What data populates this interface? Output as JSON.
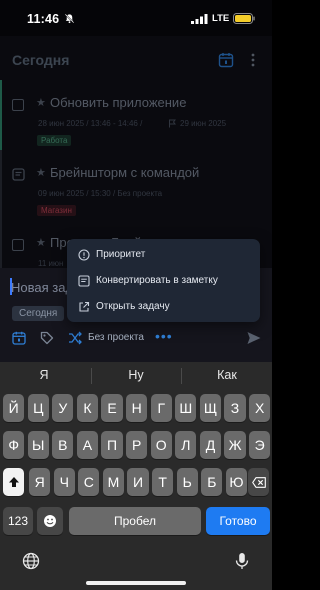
{
  "status_bar": {
    "time": "11:46",
    "network": "LTE"
  },
  "header": {
    "title": "Сегодня"
  },
  "tasks": [
    {
      "title": "Обновить приложение",
      "meta": "28 июн 2025 / 13:46 - 14:46 /",
      "due": "29 июн 2025",
      "tag": "Работа",
      "accent": "#2e8b6f",
      "tag_bg": "#1c3a30",
      "tag_fg": "#52a383"
    },
    {
      "title": "Брейншторм с командой",
      "meta": "09 июн 2025 / 15:30 / Без проекта",
      "tag": "Магазин",
      "accent": "#3a3f4d",
      "tag_bg": "#3a1a22",
      "tag_fg": "#c04558"
    },
    {
      "title": "Провести Брейншторм",
      "meta": "11 июн",
      "accent": "#3a3f4d"
    }
  ],
  "composer": {
    "placeholder": "Новая зада",
    "date_chip": "Сегодня",
    "project": "Без проекта"
  },
  "context_menu": {
    "items": [
      {
        "label": "Приоритет",
        "icon": "info-circle-icon"
      },
      {
        "label": "Конвертировать в заметку",
        "icon": "note-icon"
      },
      {
        "label": "Открыть задачу",
        "icon": "external-link-icon"
      }
    ]
  },
  "keyboard": {
    "suggestions": [
      "Я",
      "Ну",
      "Как"
    ],
    "row1": [
      "Й",
      "Ц",
      "У",
      "К",
      "Е",
      "Н",
      "Г",
      "Ш",
      "Щ",
      "З",
      "Х"
    ],
    "row2": [
      "Ф",
      "Ы",
      "В",
      "А",
      "П",
      "Р",
      "О",
      "Л",
      "Д",
      "Ж",
      "Э"
    ],
    "row3": [
      "Я",
      "Ч",
      "С",
      "М",
      "И",
      "Т",
      "Ь",
      "Б",
      "Ю"
    ],
    "numbers_label": "123",
    "space_label": "Пробел",
    "return_label": "Готово"
  },
  "colors": {
    "accent": "#1e7bf2",
    "app_bg": "#101018"
  }
}
